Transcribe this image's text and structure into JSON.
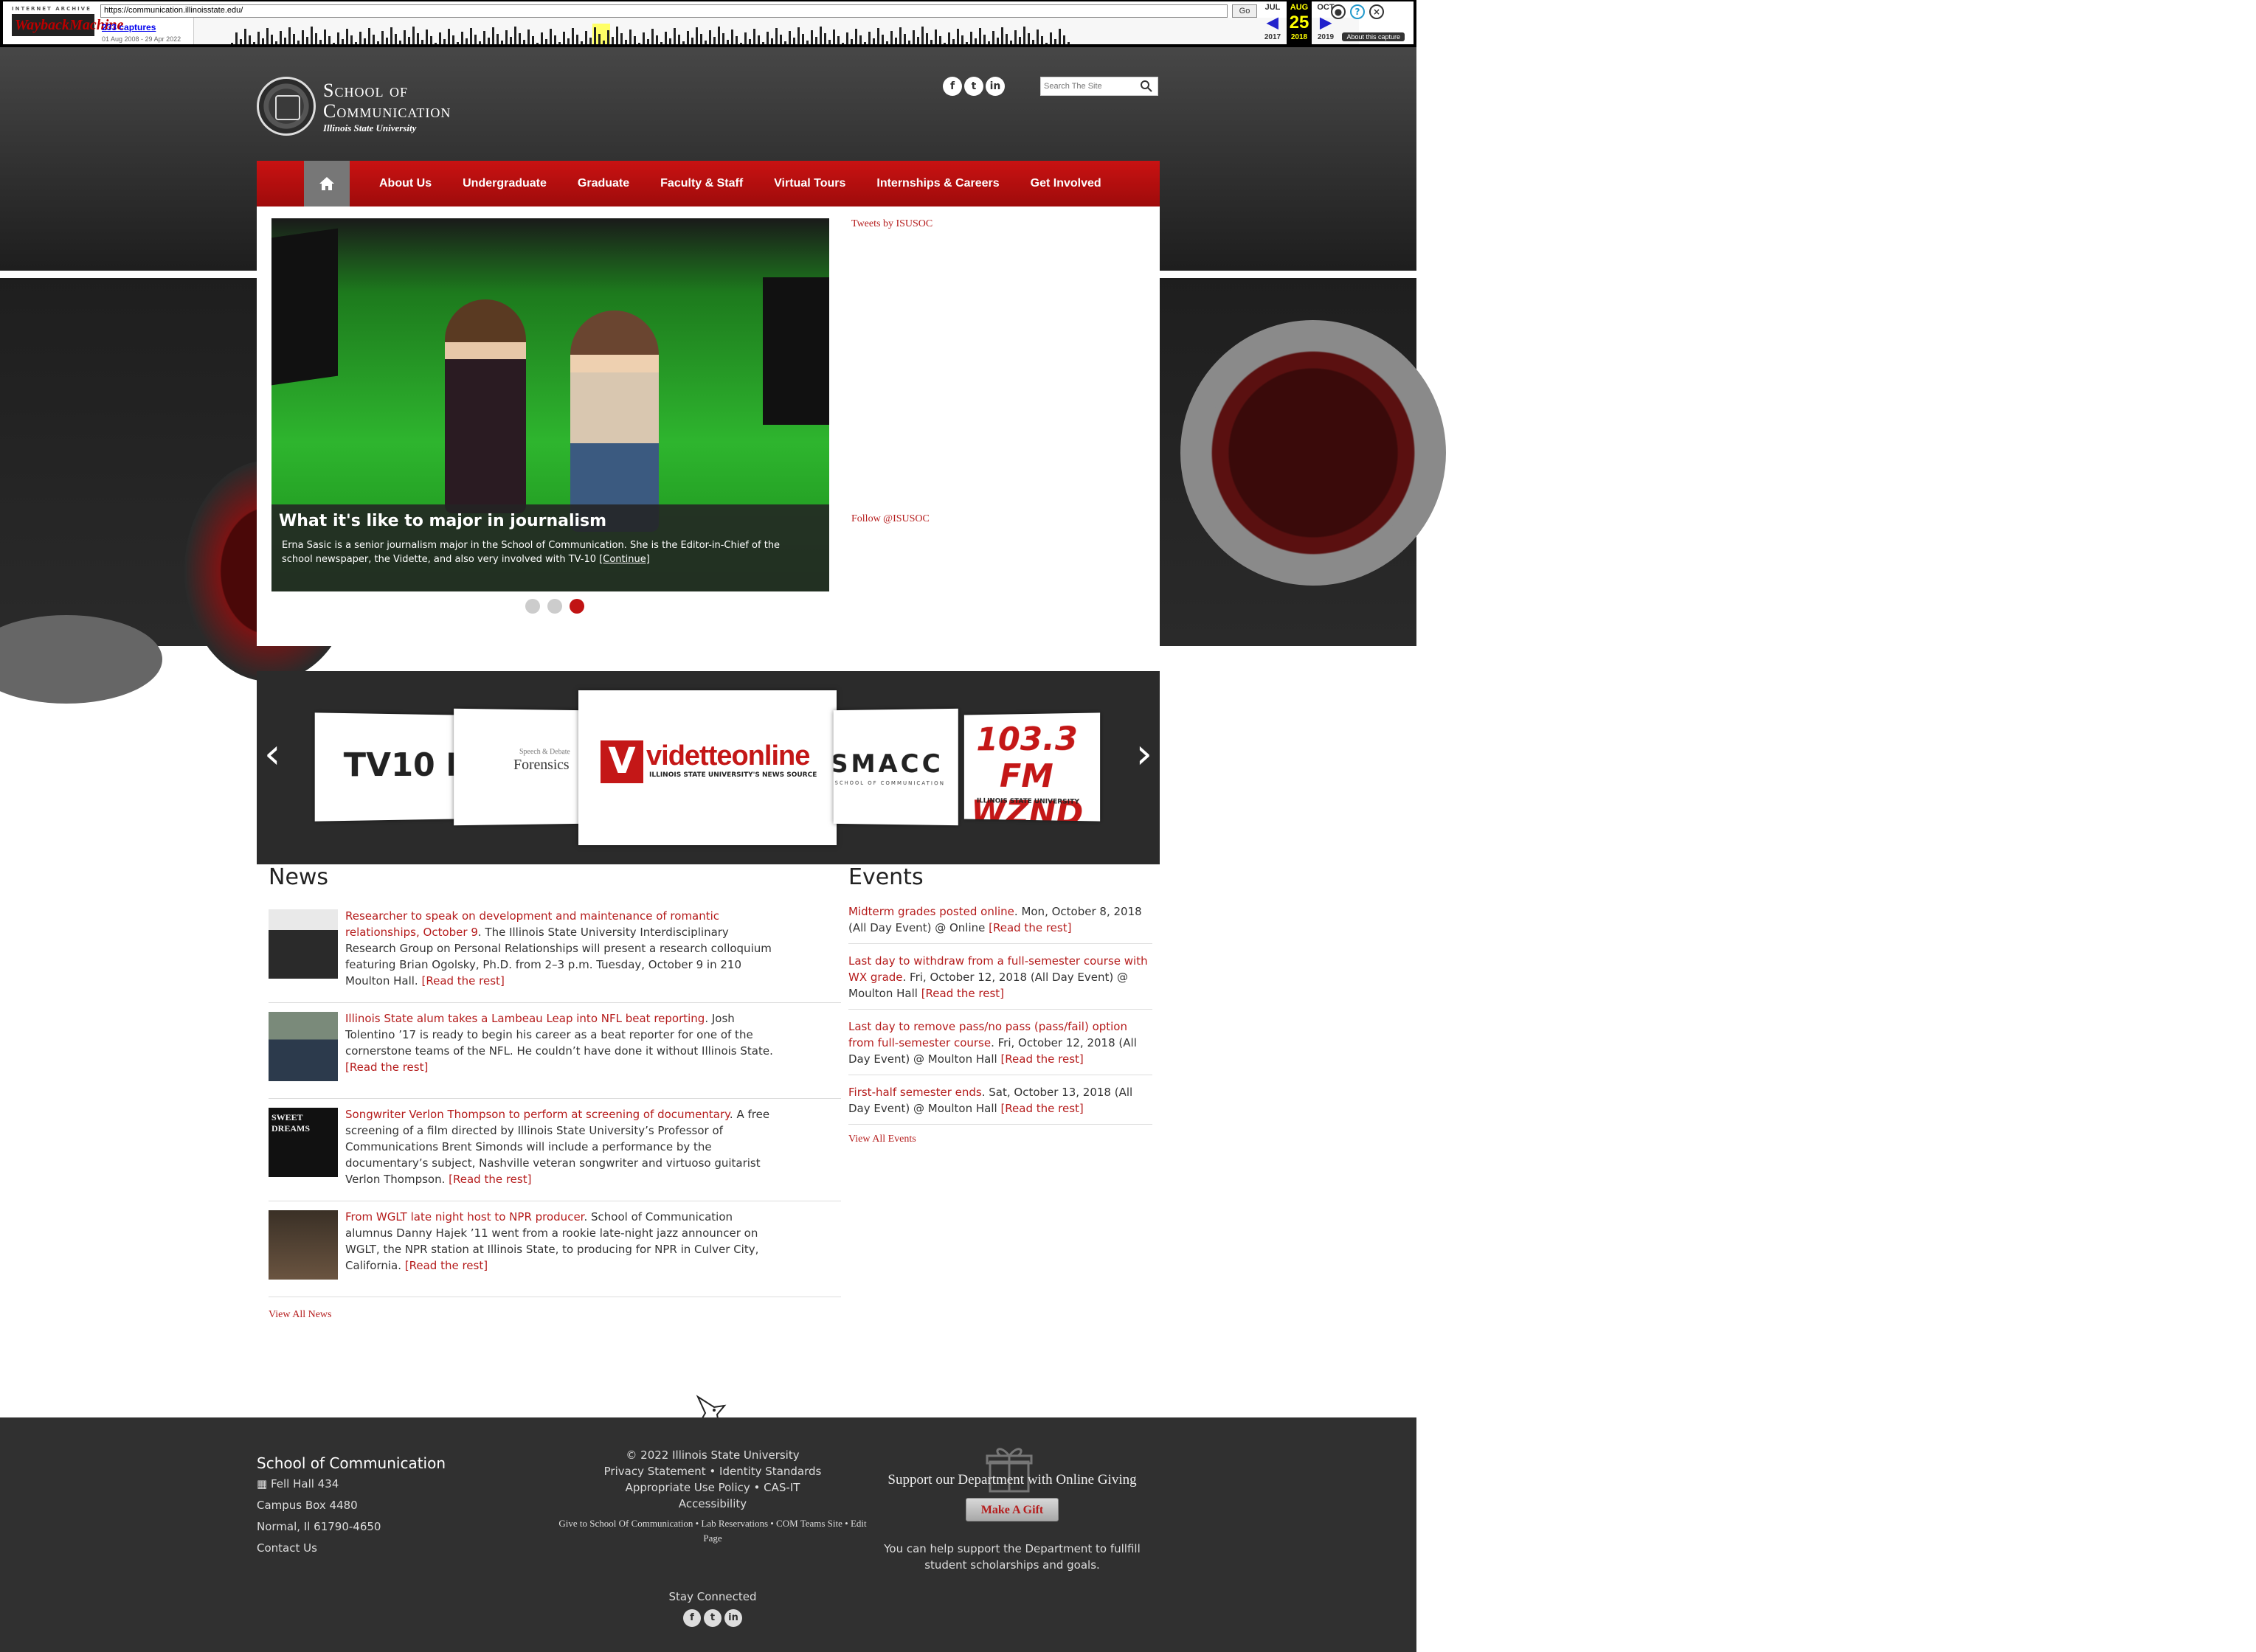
{
  "wayback": {
    "url": "https://communication.illinoisstate.edu/",
    "go_label": "Go",
    "logo_top": "INTERNET ARCHIVE",
    "logo_main": "WaybackMachine",
    "captures": "233 captures",
    "range": "01 Aug 2008 - 29 Apr 2022",
    "cal": {
      "prev": {
        "month": "JUL",
        "year": "2017"
      },
      "cur": {
        "month": "AUG",
        "day": "25",
        "year": "2018"
      },
      "next": {
        "month": "OCT",
        "year": "2019"
      }
    },
    "about": "About this capture"
  },
  "header": {
    "brand_line1": "School of",
    "brand_line2": "Communication",
    "brand_line3": "Illinois State University",
    "search_placeholder": "Search The Site"
  },
  "nav": {
    "items": [
      "About Us",
      "Undergraduate",
      "Graduate",
      "Faculty & Staff",
      "Virtual Tours",
      "Internships & Careers",
      "Get Involved"
    ]
  },
  "slider": {
    "title": "What it's like to major in journalism",
    "description": "Erna Sasic is a senior journalism major in the School of Communication. She is the Editor-in-Chief of the school newspaper, the Vidette, and also very involved with TV-10",
    "continue": "[Continue]",
    "active_slide": 3,
    "slide_count": 3
  },
  "twitter": {
    "tweets_by": "Tweets by ISUSOC",
    "follow": "Follow @ISUSOC"
  },
  "carousel": {
    "logos": {
      "tv10": "TV10 NEWS",
      "forensics_small": "Speech & Debate",
      "forensics": "Forensics",
      "vidette": "videtteonline",
      "vidette_sub": "ILLINOIS STATE UNIVERSITY'S NEWS SOURCE",
      "smacc": "SMACC",
      "smacc_sub": "SCHOOL OF COMMUNICATION",
      "wznd": "103.3 FM WZND",
      "wznd_sub": "ILLINOIS STATE UNIVERSITY"
    }
  },
  "news": {
    "title": "News",
    "items": [
      {
        "link": "Researcher to speak on development and maintenance of romantic relationships, October 9",
        "text": ". The Illinois State University Interdisciplinary Research Group on Personal Relationships will present a research colloquium featuring Brian Ogolsky, Ph.D. from 2–3 p.m. Tuesday, October 9 in 210 Moulton Hall. ",
        "more": "[Read the rest]"
      },
      {
        "link": "Illinois State alum takes a Lambeau Leap into NFL beat reporting",
        "text": ". Josh Tolentino ’17 is ready to begin his career as a beat reporter for one of the cornerstone teams of the NFL. He couldn’t have done it without Illinois State.  ",
        "more": "[Read the rest]"
      },
      {
        "link": "Songwriter Verlon Thompson to perform at screening of documentary",
        "text": ". A free screening of a film directed by Illinois State University’s Professor of Communications Brent Simonds will include a performance by the documentary’s subject, Nashville veteran songwriter and virtuoso guitarist Verlon Thompson.  ",
        "more": "[Read the rest]"
      },
      {
        "link": "From WGLT late night host to NPR producer",
        "text": ". School of Communication alumnus Danny Hajek ’11 went from a rookie late-night jazz announcer on WGLT, the NPR station at Illinois State, to producing for NPR in Culver City, California. ",
        "more": "[Read the rest]"
      }
    ],
    "thumb3_text": "SWEET DREAMS",
    "view_all": "View All News"
  },
  "events": {
    "title": "Events",
    "items": [
      {
        "link": "Midterm grades posted online",
        "text": ". Mon, October 8, 2018 (All Day Event) @ Online ",
        "more": "[Read the rest]"
      },
      {
        "link": "Last day to withdraw from a full-semester course with WX grade",
        "text": ". Fri, October 12, 2018 (All Day Event) @ Moulton Hall ",
        "more": "[Read the rest]"
      },
      {
        "link": "Last day to remove pass/no pass (pass/fail) option from full-semester course",
        "text": ". Fri, October 12, 2018 (All Day Event) @ Moulton Hall ",
        "more": "[Read the rest]"
      },
      {
        "link": "First-half semester ends",
        "text": ". Sat, October 13, 2018 (All Day Event) @ Moulton Hall ",
        "more": "[Read the rest]"
      }
    ],
    "view_all": "View All Events"
  },
  "footer": {
    "school": "School of Communication",
    "address1": "Fell Hall 434",
    "address2": "Campus Box 4480",
    "address3": "Normal, Il 61790-4650",
    "contact": "Contact Us",
    "copyright": "© 2022 Illinois State University",
    "links1": "Privacy Statement • Identity Standards",
    "links2": "Appropriate Use Policy • CAS-IT",
    "links3": "Accessibility",
    "links4": "Give to School Of Communication • Lab Reservations • COM Teams Site • Edit Page",
    "stay": "Stay Connected",
    "support": "Support our Department with Online Giving",
    "gift_button": "Make A Gift",
    "help": "You can help support the Department to fullfill student scholarships and goals."
  }
}
